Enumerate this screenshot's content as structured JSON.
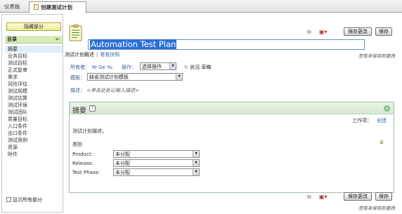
{
  "tabs": [
    {
      "label": "仪表板"
    },
    {
      "label": "创建测试计划"
    }
  ],
  "sidebar": {
    "hide_button": "隐藏部分",
    "heading": "目录",
    "items": [
      {
        "label": "摘要"
      },
      {
        "label": "业务目标"
      },
      {
        "label": "测试目标"
      },
      {
        "label": "正式复审"
      },
      {
        "label": "需求"
      },
      {
        "label": "风险评估"
      },
      {
        "label": "测试规模"
      },
      {
        "label": "测试估算"
      },
      {
        "label": "测试环境"
      },
      {
        "label": "测试团队"
      },
      {
        "label": "质量目标"
      },
      {
        "label": "入口条件"
      },
      {
        "label": "出口条件"
      },
      {
        "label": "测试用例"
      },
      {
        "label": "资源"
      },
      {
        "label": "附件"
      }
    ],
    "show_all_label": "显示所有部分"
  },
  "header": {
    "title": "Automation Test Plan",
    "save_changes": "保存更改",
    "save": "保存",
    "subtab_active": "测试计划概述",
    "subtab_other": "看看快照",
    "unsaved_note": "您有未保存的更改"
  },
  "form": {
    "owner_label": "所有者：",
    "owner_value": "Ye Ge Yu",
    "action_label": "操作：",
    "action_value": "选择操作",
    "status_label": "状况 草稿",
    "template_label": "模板：",
    "template_value": "缺省测试计划模板",
    "description_label": "描述：",
    "description_hint": "<单击此处以输入描述>"
  },
  "summary": {
    "title": "摘要",
    "work_item_label": "工作项：",
    "create_link": "创建",
    "summary_text": "测试计划描述。",
    "categories_heading": "类别",
    "categories": [
      {
        "label": "Product:",
        "value": "未分配"
      },
      {
        "label": "Release:",
        "value": "未分配"
      },
      {
        "label": "Test Phase:",
        "value": "未分配"
      }
    ]
  },
  "footer": {
    "save_changes": "保存更改",
    "save": "保存",
    "unsaved_note": "您有未保存的更改"
  },
  "colors": {
    "accent_blue": "#2b6fd6",
    "panel_green": "#d6e8d3",
    "nav_head": "#d7ebb8"
  }
}
